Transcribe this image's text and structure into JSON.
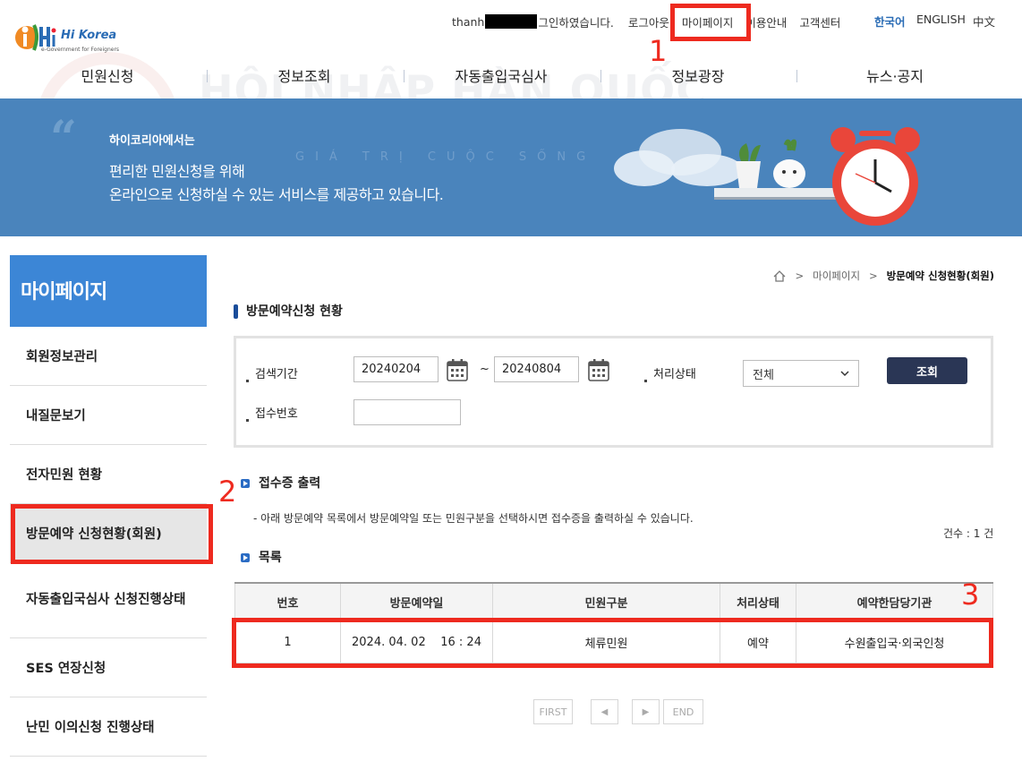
{
  "header": {
    "user_prefix": "thanh",
    "login_suffix": "그인하였습니다.",
    "links": [
      "로그아웃",
      "마이페이지",
      "이용안내",
      "고객센터"
    ],
    "languages": [
      "한국어",
      "ENGLISH",
      "中文"
    ],
    "logo_text": "Hi Korea",
    "logo_sub": "e-Government for Foreigners"
  },
  "gnb": [
    "민원신청",
    "정보조회",
    "자동출입국심사",
    "정보광장",
    "뉴스·공지"
  ],
  "banner": {
    "line1": "하이코리아에서는",
    "line2": "편리한 민원신청을 위해",
    "line3": "온라인으로 신청하실 수 있는 서비스를 제공하고 있습니다.",
    "watermark": "HỘI NHẬP HÀN QUỐC",
    "watermark_sub": "GIÁ TRỊ CUỘC SỐNG"
  },
  "sidebar": {
    "title": "마이페이지",
    "items": [
      "회원정보관리",
      "내질문보기",
      "전자민원 현황",
      "방문예약 신청현황(회원)",
      "자동출입국심사 신청진행상태",
      "SES 연장신청",
      "난민 이의신청 진행상태"
    ],
    "active_index": 3
  },
  "breadcrumb": [
    "마이페이지",
    "방문예약 신청현황(회원)"
  ],
  "page_title": "방문예약신청 현황",
  "search": {
    "period_label": "검색기간",
    "date_from": "20240204",
    "tilde": "~",
    "date_to": "20240804",
    "status_label": "처리상태",
    "status_value": "전체",
    "button": "조회",
    "receipt_label": "접수번호",
    "receipt_value": ""
  },
  "print_section": {
    "title": "접수증 출력",
    "desc": "- 아래 방문예약 목록에서 방문예약일 또는 민원구분을 선택하시면 접수증을 출력하실 수 있습니다."
  },
  "list": {
    "title": "목록",
    "count": "건수 : 1 건",
    "headers": [
      "번호",
      "방문예약일",
      "민원구분",
      "처리상태",
      "예약한담당기관"
    ],
    "rows": [
      [
        "1",
        "2024. 04. 02    16 : 24",
        "체류민원",
        "예약",
        "수원출입국·외국인청"
      ]
    ]
  },
  "pager": [
    "FIRST",
    "◀",
    "▶",
    "END"
  ],
  "annotations": [
    "1",
    "2",
    "3"
  ],
  "colors": {
    "accent_blue": "#3c86d6",
    "banner_blue": "#4a84bc",
    "button_navy": "#2a3655",
    "annotation_red": "#ee2a1f",
    "lang_active": "#2a6cb5"
  }
}
